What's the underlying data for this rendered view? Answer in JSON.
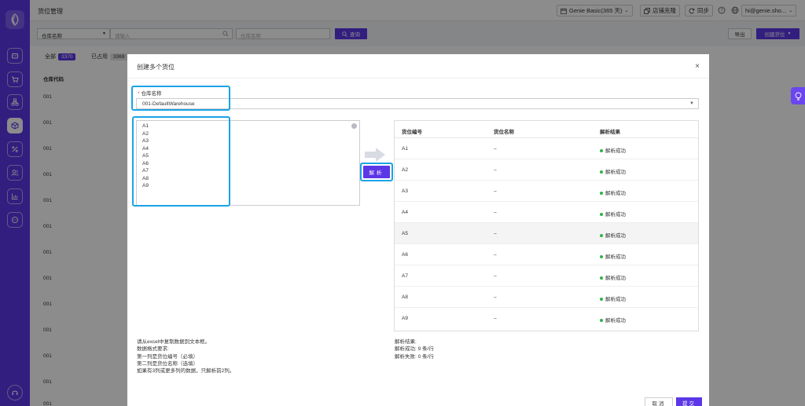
{
  "header": {
    "title": "货位管理",
    "plan": "Genie Basic(365 天)",
    "store_clone": "店铺克隆",
    "sync": "同步",
    "user": "hi@genie.sho..."
  },
  "toolbar": {
    "field_select": "仓库名称",
    "input_placeholder": "请输入",
    "warehouse_placeholder": "仓库名称",
    "query": "查询",
    "export": "导出",
    "create": "创建货位"
  },
  "tabs": [
    {
      "label": "全部",
      "count": "3370"
    },
    {
      "label": "已占用",
      "count": "3369"
    }
  ],
  "bg_table": {
    "header": "仓库代码",
    "rows": [
      "001",
      "001",
      "001",
      "001",
      "001",
      "001",
      "001",
      "001",
      "001",
      "001",
      "001",
      "001",
      "001"
    ]
  },
  "modal": {
    "title": "创建多个货位",
    "close": "×",
    "warehouse_label": "仓库名称",
    "required_mark": "*",
    "warehouse_value": "001-DefaultWarehouse",
    "caret": "▼",
    "textarea_lines": [
      "A1",
      "A2",
      "A3",
      "A4",
      "A5",
      "A6",
      "A7",
      "A8",
      "A9"
    ],
    "parse": "解析",
    "result_headers": {
      "code": "货位编号",
      "name": "货位名称",
      "result": "解析结果"
    },
    "result_rows": [
      {
        "code": "A1",
        "name": "–",
        "result": "解析成功"
      },
      {
        "code": "A2",
        "name": "–",
        "result": "解析成功"
      },
      {
        "code": "A3",
        "name": "–",
        "result": "解析成功"
      },
      {
        "code": "A4",
        "name": "–",
        "result": "解析成功"
      },
      {
        "code": "A5",
        "name": "–",
        "result": "解析成功"
      },
      {
        "code": "A6",
        "name": "–",
        "result": "解析成功"
      },
      {
        "code": "A7",
        "name": "–",
        "result": "解析成功"
      },
      {
        "code": "A8",
        "name": "–",
        "result": "解析成功"
      },
      {
        "code": "A9",
        "name": "–",
        "result": "解析成功"
      }
    ],
    "notes": [
      "请从excel中复制数据到文本框。",
      "数据格式要求:",
      "第一列是货位编号（必填）",
      "第二列是货位名称（选填）",
      "如果有3列或更多列的数据，只解析前2列。"
    ],
    "result_notes": [
      "解析结果:",
      "解析成功: 9 条/行",
      "解析失败: 0 条/行"
    ],
    "cancel": "取消",
    "submit": "提交"
  },
  "colors": {
    "brand": "#5b37e8",
    "highlight": "#1aa3e8",
    "success": "#2db34a"
  },
  "icons": [
    "logo-icon",
    "store-icon",
    "cart-icon",
    "sitemap-icon",
    "box-icon",
    "percent-icon",
    "users-icon",
    "chart-icon",
    "chat-icon",
    "headset-icon",
    "calendar-icon",
    "clone-icon",
    "sync-icon",
    "help-icon",
    "globe-icon",
    "search-icon",
    "bulb-icon",
    "arrow-right-icon"
  ]
}
